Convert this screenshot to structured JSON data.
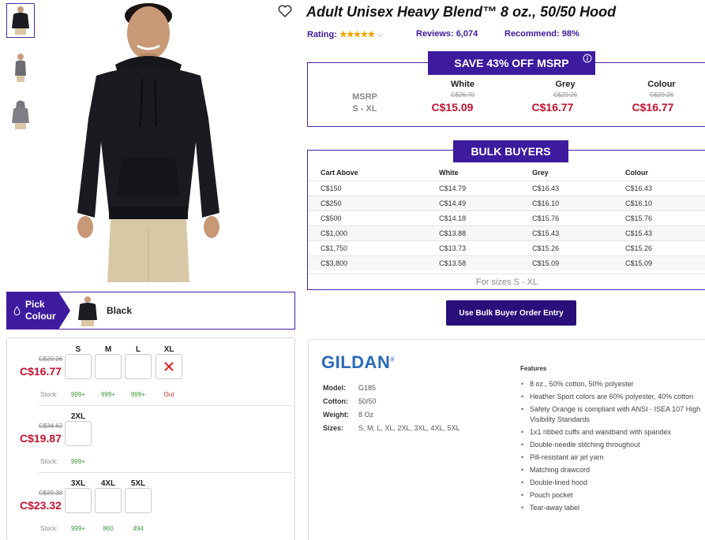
{
  "product": {
    "title": "Adult Unisex Heavy Blend™ 8 oz., 50/50 Hood",
    "rating_label": "Rating:",
    "rating_stars": "★★★★★",
    "rating_value": 4.5,
    "reviews": "Reviews: 6,074",
    "recommend": "Recommend:  98%"
  },
  "colors": {
    "brand_purple": "#3d1a9e",
    "sale_red": "#c4122f",
    "stock_green": "#3a9a3a",
    "gildan_blue": "#2a6ab8"
  },
  "thumbnails": [
    {
      "name": "front-view",
      "selected": true
    },
    {
      "name": "side-view",
      "selected": false
    },
    {
      "name": "back-view",
      "selected": false
    }
  ],
  "pick": {
    "label_line1": "Pick",
    "label_line2": "Colour",
    "selected_color": "Black"
  },
  "size_rows": [
    {
      "old_price": "C$29.26",
      "price": "C$16.77",
      "sizes": [
        {
          "label": "S",
          "stock": "999+",
          "out": false
        },
        {
          "label": "M",
          "stock": "999+",
          "out": false
        },
        {
          "label": "L",
          "stock": "999+",
          "out": false
        },
        {
          "label": "XL",
          "stock": "Out",
          "out": true
        }
      ]
    },
    {
      "old_price": "C$34.62",
      "price": "C$19.87",
      "sizes": [
        {
          "label": "2XL",
          "stock": "999+",
          "out": false
        }
      ]
    },
    {
      "old_price": "C$39.30",
      "price": "C$23.32",
      "sizes": [
        {
          "label": "3XL",
          "stock": "999+",
          "out": false
        },
        {
          "label": "4XL",
          "stock": "860",
          "out": false
        },
        {
          "label": "5XL",
          "stock": "494",
          "out": false
        }
      ]
    }
  ],
  "stock_label": "Stock:",
  "msrp": {
    "banner": "SAVE 43% OFF MSRP",
    "info_icon": "info-icon",
    "label_line1": "MSRP",
    "label_line2": "S - XL",
    "columns": [
      {
        "name": "White",
        "old": "C$26.70",
        "price": "C$15.09"
      },
      {
        "name": "Grey",
        "old": "C$29.26",
        "price": "C$16.77"
      },
      {
        "name": "Colour",
        "old": "C$29.26",
        "price": "C$16.77"
      }
    ]
  },
  "bulk": {
    "banner": "BULK BUYERS",
    "headers": [
      "Cart Above",
      "White",
      "Grey",
      "Colour"
    ],
    "rows": [
      [
        "C$150",
        "C$14.79",
        "C$16.43",
        "C$16.43"
      ],
      [
        "C$250",
        "C$14.49",
        "C$16.10",
        "C$16.10"
      ],
      [
        "C$500",
        "C$14.18",
        "C$15.76",
        "C$15.76"
      ],
      [
        "C$1,000",
        "C$13.88",
        "C$15.43",
        "C$15.43"
      ],
      [
        "C$1,750",
        "C$13.73",
        "C$15.26",
        "C$15.26"
      ],
      [
        "C$3,800",
        "C$13.58",
        "C$15.09",
        "C$15.09"
      ]
    ],
    "footer": "For sizes S - XL",
    "button": "Use Bulk Buyer Order Entry"
  },
  "details": {
    "brand": "GILDAN",
    "brand_mark": "®",
    "specs": [
      {
        "label": "Model:",
        "value": "G185"
      },
      {
        "label": "Cotton:",
        "value": "50/50"
      },
      {
        "label": "Weight:",
        "value": "8 Oz"
      },
      {
        "label": "Sizes:",
        "value": "S, M, L, XL, 2XL, 3XL, 4XL, 5XL"
      }
    ],
    "features_heading": "Features",
    "features": [
      "8 oz., 50% cotton, 50% polyester",
      "Heather Sport colors are 60% polyester, 40% cotton",
      "Safety Orange is compliant with ANSI - ISEA 107 High Visibility Standards",
      "1x1 ribbed cuffs and waistband with spandex",
      "Double-needle stitching throughout",
      "Pill-resistant air jet yarn",
      "Matching drawcord",
      "Double-lined hood",
      "Pouch pocket",
      "Tear-away label"
    ]
  }
}
